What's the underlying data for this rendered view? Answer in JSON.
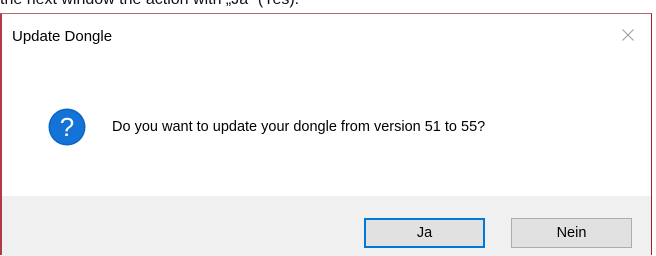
{
  "caption": "the next window the action with „Ja“ (Yes).",
  "window": {
    "title": "Update Dongle",
    "close_icon": "close-icon"
  },
  "message": {
    "icon": "question-icon",
    "text": "Do you want to update your dongle from version 51 to 55?"
  },
  "buttons": {
    "yes_label": "Ja",
    "no_label": "Nein"
  },
  "colors": {
    "accent": "#0078d7",
    "question_icon": "#0a66c2",
    "footer_bg": "#f0f0f0",
    "button_bg": "#e1e1e1"
  }
}
